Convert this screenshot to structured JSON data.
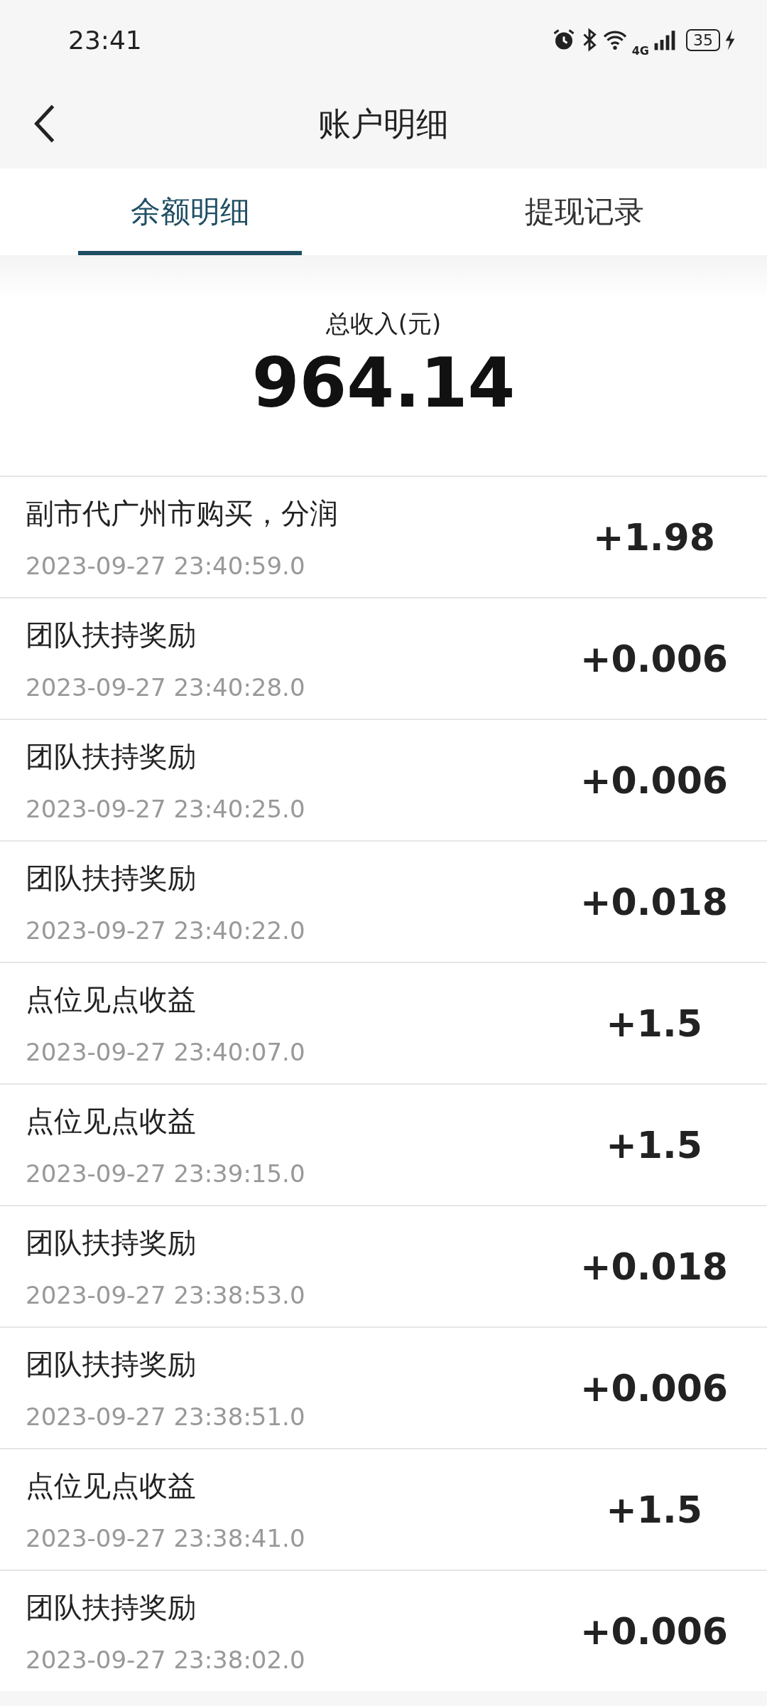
{
  "status_bar": {
    "time": "23:41",
    "network": "4G",
    "battery": "35"
  },
  "header": {
    "title": "账户明细"
  },
  "tabs": [
    {
      "label": "余额明细",
      "selected": true
    },
    {
      "label": "提现记录",
      "selected": false
    }
  ],
  "summary": {
    "label": "总收入(元)",
    "amount": "964.14"
  },
  "records": [
    {
      "title": "副市代广州市购买，分润",
      "time": "2023-09-27 23:40:59.0",
      "amount": "+1.98"
    },
    {
      "title": "团队扶持奖励",
      "time": "2023-09-27 23:40:28.0",
      "amount": "+0.006"
    },
    {
      "title": "团队扶持奖励",
      "time": "2023-09-27 23:40:25.0",
      "amount": "+0.006"
    },
    {
      "title": "团队扶持奖励",
      "time": "2023-09-27 23:40:22.0",
      "amount": "+0.018"
    },
    {
      "title": "点位见点收益",
      "time": "2023-09-27 23:40:07.0",
      "amount": "+1.5"
    },
    {
      "title": "点位见点收益",
      "time": "2023-09-27 23:39:15.0",
      "amount": "+1.5"
    },
    {
      "title": "团队扶持奖励",
      "time": "2023-09-27 23:38:53.0",
      "amount": "+0.018"
    },
    {
      "title": "团队扶持奖励",
      "time": "2023-09-27 23:38:51.0",
      "amount": "+0.006"
    },
    {
      "title": "点位见点收益",
      "time": "2023-09-27 23:38:41.0",
      "amount": "+1.5"
    },
    {
      "title": "团队扶持奖励",
      "time": "2023-09-27 23:38:02.0",
      "amount": "+0.006"
    }
  ]
}
